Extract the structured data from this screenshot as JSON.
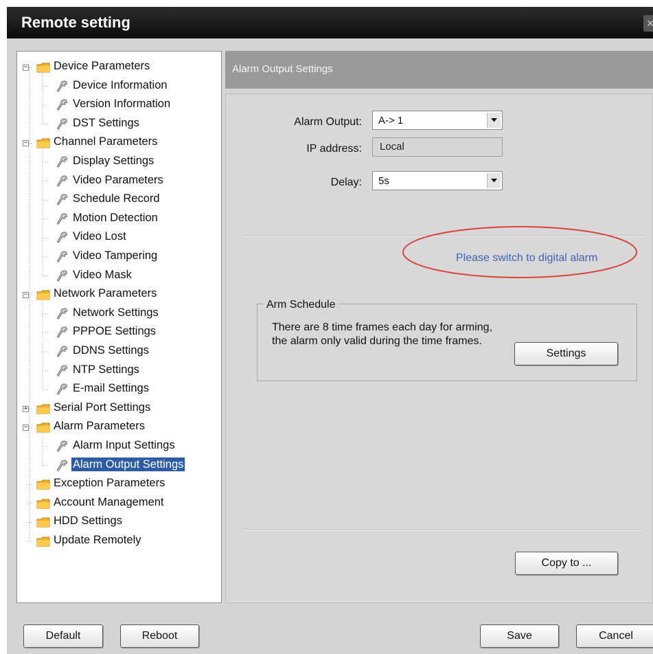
{
  "window": {
    "title": "Remote setting",
    "close_glyph": "×"
  },
  "tree": [
    {
      "label": "Device Parameters",
      "type": "folder",
      "expander": "−"
    },
    {
      "label": "Device Information",
      "type": "leaf"
    },
    {
      "label": "Version Information",
      "type": "leaf"
    },
    {
      "label": "DST Settings",
      "type": "leaf"
    },
    {
      "label": "Channel Parameters",
      "type": "folder",
      "expander": "−"
    },
    {
      "label": "Display Settings",
      "type": "leaf"
    },
    {
      "label": "Video Parameters",
      "type": "leaf"
    },
    {
      "label": "Schedule Record",
      "type": "leaf"
    },
    {
      "label": "Motion Detection",
      "type": "leaf"
    },
    {
      "label": "Video Lost",
      "type": "leaf"
    },
    {
      "label": "Video Tampering",
      "type": "leaf"
    },
    {
      "label": "Video Mask",
      "type": "leaf"
    },
    {
      "label": "Network Parameters",
      "type": "folder",
      "expander": "−"
    },
    {
      "label": "Network Settings",
      "type": "leaf"
    },
    {
      "label": "PPPOE Settings",
      "type": "leaf"
    },
    {
      "label": "DDNS Settings",
      "type": "leaf"
    },
    {
      "label": "NTP Settings",
      "type": "leaf"
    },
    {
      "label": "E-mail Settings",
      "type": "leaf"
    },
    {
      "label": "Serial Port Settings",
      "type": "folder",
      "expander": "+"
    },
    {
      "label": "Alarm Parameters",
      "type": "folder",
      "expander": "−"
    },
    {
      "label": "Alarm Input Settings",
      "type": "leaf"
    },
    {
      "label": "Alarm Output Settings",
      "type": "leaf",
      "selected": true
    },
    {
      "label": "Exception Parameters",
      "type": "folder"
    },
    {
      "label": "Account Management",
      "type": "folder"
    },
    {
      "label": "HDD Settings",
      "type": "folder"
    },
    {
      "label": "Update Remotely",
      "type": "folder"
    }
  ],
  "panel": {
    "header": "Alarm Output Settings",
    "alarm_output_label": "Alarm Output:",
    "alarm_output_value": "A-> 1",
    "ip_label": "IP address:",
    "ip_value": "Local",
    "delay_label": "Delay:",
    "delay_value": "5s",
    "digital_alarm_note": "Please switch to digital alarm",
    "arm_schedule": {
      "title": "Arm Schedule",
      "description": "There are 8 time frames each day for arming, the alarm only valid during the time frames.",
      "settings_label": "Settings"
    },
    "copy_label": "Copy to ..."
  },
  "footer": {
    "default_label": "Default",
    "reboot_label": "Reboot",
    "save_label": "Save",
    "cancel_label": "Cancel"
  },
  "colors": {
    "selection": "#2c5ca8",
    "highlight_ellipse": "#d9443c",
    "link": "#3f63b8"
  },
  "icons": {
    "folder": "folder-icon",
    "leaf": "wrench-icon",
    "dropdown": "chevron-down-icon"
  }
}
